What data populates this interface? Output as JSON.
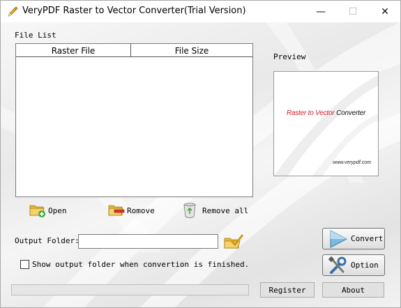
{
  "window": {
    "title": "VeryPDF Raster to Vector Converter(Trial Version)",
    "controls": {
      "minimize": "—",
      "maximize": "☐",
      "close": "✕"
    }
  },
  "file_list": {
    "label": "File List",
    "columns": [
      "Raster File",
      "File Size"
    ],
    "rows": []
  },
  "preview": {
    "label": "Preview",
    "title_red": "Raster to Vector ",
    "title_black": "Converter",
    "url": "www.verypdf.com"
  },
  "toolbar": {
    "open_label": "Open",
    "remove_label": "Romove",
    "remove_all_label": "Remove all"
  },
  "output": {
    "label": "Output Folder:",
    "value": "",
    "show_folder_label": "Show output folder when convertion is finished.",
    "show_folder_checked": false
  },
  "actions": {
    "convert_label": "Convert",
    "option_label": "Option",
    "register_label": "Register",
    "about_label": "About"
  },
  "progress": {
    "value": 0
  },
  "colors": {
    "accent_red": "#d0202a",
    "folder_yellow": "#f2c94c",
    "add_green": "#3aa93a",
    "remove_red": "#d9342b"
  },
  "icons": {
    "app": "pencil-icon",
    "open": "folder-add-icon",
    "remove": "folder-remove-icon",
    "remove_all": "recycle-bin-icon",
    "browse": "folder-check-icon",
    "convert": "play-icon",
    "option": "tools-icon"
  }
}
